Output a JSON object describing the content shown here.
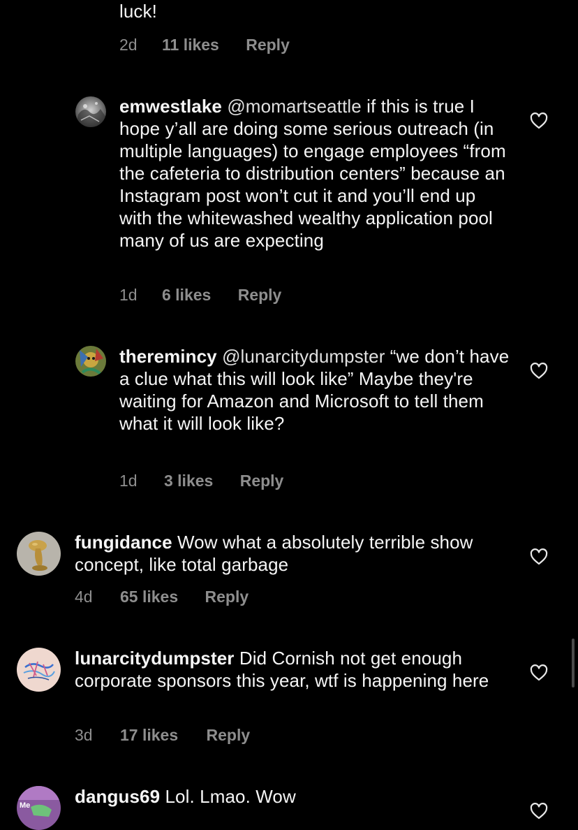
{
  "comments": [
    {
      "body": "luck!",
      "age": "2d",
      "likes": "11 likes",
      "reply": "Reply"
    },
    {
      "username": "emwestlake",
      "mention": "@momartseattle",
      "text": " if this is true I hope y’all are doing some serious outreach (in multiple languages) to engage employees “from the cafeteria to distribution centers” because an Instagram post won’t cut it and you’ll end up with the whitewashed wealthy application pool many of us are expecting",
      "age": "1d",
      "likes": "6 likes",
      "reply": "Reply",
      "avatar_icon": "grey-texture-avatar",
      "like_icon": "heart-outline-icon"
    },
    {
      "username": "theremincy",
      "mention": "@lunarcitydumpster",
      "text": " “we don’t have a clue what this will look like” Maybe they're waiting for Amazon and Microsoft to tell them what it will look like?",
      "age": "1d",
      "likes": "3 likes",
      "reply": "Reply",
      "avatar_icon": "colorful-art-avatar",
      "like_icon": "heart-outline-icon"
    },
    {
      "username": "fungidance",
      "text": " Wow what a absolutely terrible show concept, like total garbage",
      "age": "4d",
      "likes": "65 likes",
      "reply": "Reply",
      "avatar_icon": "gold-sculpture-avatar",
      "like_icon": "heart-outline-icon"
    },
    {
      "username": "lunarcitydumpster",
      "text": " Did Cornish not get enough corporate sponsors this year, wtf is happening here",
      "age": "3d",
      "likes": "17 likes",
      "reply": "Reply",
      "avatar_icon": "sketch-avatar",
      "like_icon": "heart-outline-icon"
    },
    {
      "username": "dangus69",
      "text": " Lol. Lmao. Wow",
      "avatar_label": "Me",
      "avatar_icon": "purple-photo-avatar",
      "like_icon": "heart-outline-icon"
    }
  ],
  "colors": {
    "background": "#000000",
    "text": "#f5f5f5",
    "meta": "#8e8e8e"
  }
}
